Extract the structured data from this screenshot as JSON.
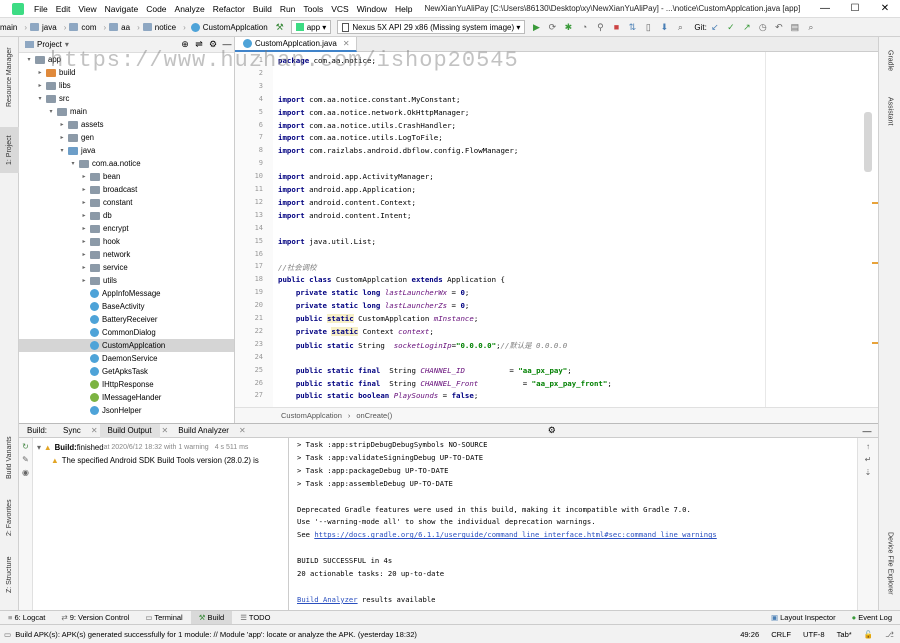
{
  "menubar": {
    "items": [
      "File",
      "Edit",
      "View",
      "Navigate",
      "Code",
      "Analyze",
      "Refactor",
      "Build",
      "Run",
      "Tools",
      "VCS",
      "Window",
      "Help"
    ],
    "title": "NewXianYuAliPay [C:\\Users\\86130\\Desktop\\xy\\NewXianYuAliPay] - ...\\notice\\CustomApplcation.java [app]",
    "minimize": "—",
    "maximize": "☐",
    "close": "✕"
  },
  "toolbar": {
    "crumbs": [
      "main",
      "java",
      "com",
      "aa",
      "notice",
      "CustomApplcation"
    ],
    "run_config": "app",
    "device": "Nexus 5X API 29 x86 (Missing system image)",
    "git_label": "Git:"
  },
  "left_strip": [
    "Resource Manager",
    "1: Project",
    "Build Variants",
    "2: Favorites",
    "Z: Structure"
  ],
  "right_strip": [
    "Gradle",
    "Assistant",
    "Device File Explorer"
  ],
  "project": {
    "header": "Project",
    "tree": [
      {
        "label": "app",
        "depth": 1,
        "kind": "folder",
        "expanded": true
      },
      {
        "label": "build",
        "depth": 2,
        "kind": "folder-orange",
        "expanded": false
      },
      {
        "label": "libs",
        "depth": 2,
        "kind": "folder",
        "expanded": false
      },
      {
        "label": "src",
        "depth": 2,
        "kind": "folder",
        "expanded": true
      },
      {
        "label": "main",
        "depth": 3,
        "kind": "folder",
        "expanded": true
      },
      {
        "label": "assets",
        "depth": 4,
        "kind": "folder",
        "expanded": false
      },
      {
        "label": "gen",
        "depth": 4,
        "kind": "folder",
        "expanded": false
      },
      {
        "label": "java",
        "depth": 4,
        "kind": "folder-blue",
        "expanded": true
      },
      {
        "label": "com.aa.notice",
        "depth": 5,
        "kind": "folder",
        "expanded": true
      },
      {
        "label": "bean",
        "depth": 6,
        "kind": "folder",
        "expanded": false
      },
      {
        "label": "broadcast",
        "depth": 6,
        "kind": "folder",
        "expanded": false
      },
      {
        "label": "constant",
        "depth": 6,
        "kind": "folder",
        "expanded": false
      },
      {
        "label": "db",
        "depth": 6,
        "kind": "folder",
        "expanded": false
      },
      {
        "label": "encrypt",
        "depth": 6,
        "kind": "folder",
        "expanded": false
      },
      {
        "label": "hook",
        "depth": 6,
        "kind": "folder",
        "expanded": false
      },
      {
        "label": "network",
        "depth": 6,
        "kind": "folder",
        "expanded": false
      },
      {
        "label": "service",
        "depth": 6,
        "kind": "folder",
        "expanded": false
      },
      {
        "label": "utils",
        "depth": 6,
        "kind": "folder",
        "expanded": false
      },
      {
        "label": "AppInfoMessage",
        "depth": 6,
        "kind": "class"
      },
      {
        "label": "BaseActivity",
        "depth": 6,
        "kind": "class"
      },
      {
        "label": "BatteryReceiver",
        "depth": 6,
        "kind": "class"
      },
      {
        "label": "CommonDialog",
        "depth": 6,
        "kind": "class"
      },
      {
        "label": "CustomApplcation",
        "depth": 6,
        "kind": "class",
        "selected": true
      },
      {
        "label": "DaemonService",
        "depth": 6,
        "kind": "class"
      },
      {
        "label": "GetApksTask",
        "depth": 6,
        "kind": "class"
      },
      {
        "label": "IHttpResponse",
        "depth": 6,
        "kind": "interface"
      },
      {
        "label": "IMessageHander",
        "depth": 6,
        "kind": "interface"
      },
      {
        "label": "JsonHelper",
        "depth": 6,
        "kind": "class"
      }
    ]
  },
  "editor": {
    "tab": "CustomApplcation.java",
    "line_numbers": [
      "1",
      "2",
      "3",
      "4",
      "5",
      "6",
      "7",
      "8",
      "9",
      "10",
      "11",
      "12",
      "13",
      "14",
      "15",
      "16",
      "17",
      "18",
      "19",
      "20",
      "21",
      "22",
      "23",
      "24",
      "25",
      "26",
      "27"
    ],
    "lines": [
      [
        {
          "t": "package",
          "c": "kw"
        },
        {
          "t": " com.aa.notice;"
        }
      ],
      [],
      [],
      [
        {
          "t": "import",
          "c": "kw"
        },
        {
          "t": " com.aa.notice.constant.MyConstant;"
        }
      ],
      [
        {
          "t": "import",
          "c": "kw"
        },
        {
          "t": " com.aa.notice.network.OkHttpManager;"
        }
      ],
      [
        {
          "t": "import",
          "c": "kw"
        },
        {
          "t": " com.aa.notice.utils.CrashHandler;"
        }
      ],
      [
        {
          "t": "import",
          "c": "kw"
        },
        {
          "t": " com.aa.notice.utils.LogToFile;"
        }
      ],
      [
        {
          "t": "import",
          "c": "kw"
        },
        {
          "t": " com.raizlabs.android.dbflow.config.FlowManager;"
        }
      ],
      [],
      [
        {
          "t": "import",
          "c": "kw"
        },
        {
          "t": " android.app.ActivityManager;"
        }
      ],
      [
        {
          "t": "import",
          "c": "kw"
        },
        {
          "t": " android.app.Application;"
        }
      ],
      [
        {
          "t": "import",
          "c": "kw"
        },
        {
          "t": " android.content.Context;"
        }
      ],
      [
        {
          "t": "import",
          "c": "kw"
        },
        {
          "t": " android.content.Intent;"
        }
      ],
      [],
      [
        {
          "t": "import",
          "c": "kw"
        },
        {
          "t": " java.util.List;"
        }
      ],
      [],
      [
        {
          "t": "//社会调校",
          "c": "cmt"
        }
      ],
      [
        {
          "t": "public class",
          "c": "kw"
        },
        {
          "t": " CustomApplcation "
        },
        {
          "t": "extends",
          "c": "kw"
        },
        {
          "t": " Application {"
        }
      ],
      [
        {
          "t": "    "
        },
        {
          "t": "private static long",
          "c": "kw"
        },
        {
          "t": " "
        },
        {
          "t": "lastLauncherWx",
          "c": "fld"
        },
        {
          "t": " = "
        },
        {
          "t": "0",
          "c": "kw"
        },
        {
          "t": ";"
        }
      ],
      [
        {
          "t": "    "
        },
        {
          "t": "private static long",
          "c": "kw"
        },
        {
          "t": " "
        },
        {
          "t": "lastLauncherZs",
          "c": "fld"
        },
        {
          "t": " = "
        },
        {
          "t": "0",
          "c": "kw"
        },
        {
          "t": ";"
        }
      ],
      [
        {
          "t": "    "
        },
        {
          "t": "public ",
          "c": "kw"
        },
        {
          "t": "static",
          "c": "kw hl"
        },
        {
          "t": " CustomApplcation "
        },
        {
          "t": "mInstance",
          "c": "fld"
        },
        {
          "t": ";"
        }
      ],
      [
        {
          "t": "    "
        },
        {
          "t": "private ",
          "c": "kw"
        },
        {
          "t": "static",
          "c": "kw hl"
        },
        {
          "t": " Context "
        },
        {
          "t": "context",
          "c": "fld"
        },
        {
          "t": ";"
        }
      ],
      [
        {
          "t": "    "
        },
        {
          "t": "public static",
          "c": "kw"
        },
        {
          "t": " String  "
        },
        {
          "t": "socketLoginIp",
          "c": "fld"
        },
        {
          "t": "="
        },
        {
          "t": "\"0.0.0.0\"",
          "c": "str"
        },
        {
          "t": ";"
        },
        {
          "t": "//默认是 0.0.0.0",
          "c": "cmt"
        }
      ],
      [],
      [
        {
          "t": "    "
        },
        {
          "t": "public static final",
          "c": "kw"
        },
        {
          "t": "  String "
        },
        {
          "t": "CHANNEL_ID",
          "c": "fld"
        },
        {
          "t": "          = "
        },
        {
          "t": "\"aa_px_pay\"",
          "c": "str"
        },
        {
          "t": ";"
        }
      ],
      [
        {
          "t": "    "
        },
        {
          "t": "public static final",
          "c": "kw"
        },
        {
          "t": "  String "
        },
        {
          "t": "CHANNEL_Front",
          "c": "fld"
        },
        {
          "t": "          = "
        },
        {
          "t": "\"aa_px_pay_front\"",
          "c": "str"
        },
        {
          "t": ";"
        }
      ],
      [
        {
          "t": "    "
        },
        {
          "t": "public static boolean",
          "c": "kw"
        },
        {
          "t": " "
        },
        {
          "t": "PlaySounds",
          "c": "fld"
        },
        {
          "t": " = "
        },
        {
          "t": "false",
          "c": "kw"
        },
        {
          "t": ";"
        }
      ]
    ],
    "breadcrumb": [
      "CustomApplcation",
      "onCreate()"
    ]
  },
  "build": {
    "header_label": "Build:",
    "tabs": [
      "Sync",
      "Build Output",
      "Build Analyzer"
    ],
    "active_tab": "Build Output",
    "tree": [
      {
        "bold": "Build:",
        "text": " finished",
        "muted": " at 2020/6/12 18:32 with 1 warning",
        "time": "4 s 511 ms"
      },
      {
        "text": "The specified Android SDK Build Tools version (28.0.2) is"
      }
    ],
    "console": [
      {
        "t": "> Task :app:stripDebugDebugSymbols NO-SOURCE"
      },
      {
        "t": "> Task :app:validateSigningDebug UP-TO-DATE"
      },
      {
        "t": "> Task :app:packageDebug UP-TO-DATE"
      },
      {
        "t": "> Task :app:assembleDebug UP-TO-DATE"
      },
      {
        "t": ""
      },
      {
        "t": "Deprecated Gradle features were used in this build, making it incompatible with Gradle 7.0."
      },
      {
        "t": "Use '--warning-mode all' to show the individual deprecation warnings."
      },
      {
        "t": "See ",
        "link": "https://docs.gradle.org/6.1.1/userguide/command_line_interface.html#sec:command_line_warnings"
      },
      {
        "t": ""
      },
      {
        "t": "BUILD SUCCESSFUL in 4s"
      },
      {
        "t": "20 actionable tasks: 20 up-to-date"
      },
      {
        "t": ""
      },
      {
        "t": "",
        "link": "Build Analyzer",
        "after": " results available"
      }
    ]
  },
  "tooltabs": {
    "left": [
      "6: Logcat",
      "9: Version Control",
      "Terminal",
      "Build",
      "TODO"
    ],
    "active": "Build",
    "right": [
      "Layout Inspector",
      "Event Log"
    ]
  },
  "statusbar": {
    "message": "Build APK(s): APK(s) generated successfully for 1 module: // Module 'app': locate or analyze the APK. (yesterday 18:32)",
    "position": "49:26",
    "line_sep": "CRLF",
    "encoding": "UTF-8",
    "indent": "Tab*"
  },
  "watermark": "https://www.huzhan.com/ishop20545"
}
